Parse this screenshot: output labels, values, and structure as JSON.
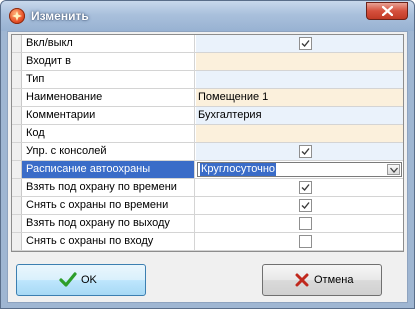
{
  "window": {
    "title": "Изменить",
    "close_icon": "close-icon"
  },
  "grid": {
    "rows": [
      {
        "label": "Вкл/выкл",
        "type": "checkbox",
        "checked": true,
        "tint": "blue"
      },
      {
        "label": "Входит в",
        "type": "text",
        "value": "",
        "tint": "peach"
      },
      {
        "label": "Тип",
        "type": "text",
        "value": "",
        "tint": "blue"
      },
      {
        "label": "Наименование",
        "type": "text",
        "value": "Помещение 1",
        "tint": "peach"
      },
      {
        "label": "Комментарии",
        "type": "text",
        "value": "Бухгалтерия",
        "tint": "blue"
      },
      {
        "label": "Код",
        "type": "text",
        "value": "",
        "tint": "peach"
      },
      {
        "label": "Упр. с консолей",
        "type": "checkbox",
        "checked": true,
        "tint": "blue"
      },
      {
        "label": "Расписание автоохраны",
        "type": "combo",
        "value": "Круглосуточно",
        "selected": true
      },
      {
        "label": "Взять под охрану по времени",
        "type": "checkbox",
        "checked": true,
        "tint": "none"
      },
      {
        "label": "Снять с охраны по времени",
        "type": "checkbox",
        "checked": true,
        "tint": "none"
      },
      {
        "label": "Взять под охрану по выходу",
        "type": "checkbox",
        "checked": false,
        "tint": "none"
      },
      {
        "label": "Снять с охраны по входу",
        "type": "checkbox",
        "checked": false,
        "tint": "none"
      }
    ]
  },
  "buttons": {
    "ok_label": "OK",
    "cancel_label": "Отмена"
  },
  "colors": {
    "selection": "#3a6cc8",
    "ok_icon": "#2e9e2a",
    "cancel_icon": "#c0281d"
  }
}
